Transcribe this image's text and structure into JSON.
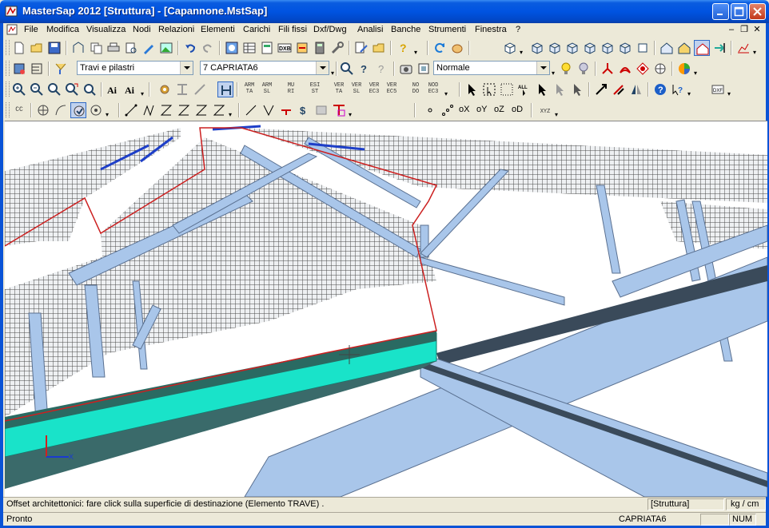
{
  "window": {
    "title": "MasterSap 2012 [Struttura] - [Capannone.MstSap]"
  },
  "menubar": {
    "items": [
      "File",
      "Modifica",
      "Visualizza",
      "Nodi",
      "Relazioni",
      "Elementi",
      "Carichi",
      "Fili fissi",
      "Dxf/Dwg",
      "Analisi",
      "Banche",
      "Strumenti",
      "Finestra",
      "?"
    ]
  },
  "toolbar2": {
    "filter_value": "Travi e pilastri",
    "group_value": "7 CAPRIATA6",
    "view_mode_value": "Normale"
  },
  "toolbar3": {
    "buttons": [
      "ARM TA",
      "ARM SL",
      "MU RI",
      "ESI ST",
      "VER TA",
      "VER SL",
      "VER EC3",
      "VER EC5",
      "NO DO",
      "NOD EC3"
    ]
  },
  "toolbar4": {
    "axis_buttons": [
      "oX",
      "oY",
      "oZ",
      "oD"
    ],
    "xyz_label": "XYZ",
    "cc_label": "CC"
  },
  "viewport": {
    "axis_label": "X"
  },
  "status": {
    "message": "Offset architettonici: fare click sulla superficie di destinazione (Elemento TRAVE) .",
    "mode": "[Struttura]",
    "units": "kg / cm",
    "ready": "Pronto",
    "current_group": "CAPRIATA6",
    "num": "NUM"
  },
  "colors": {
    "titlebar": "#0053e1",
    "beam_teal": "#19e3c9",
    "steel_blue": "#a9c6ea",
    "selection_red": "#cc2020",
    "slab_grid": "#4a4a4a"
  }
}
